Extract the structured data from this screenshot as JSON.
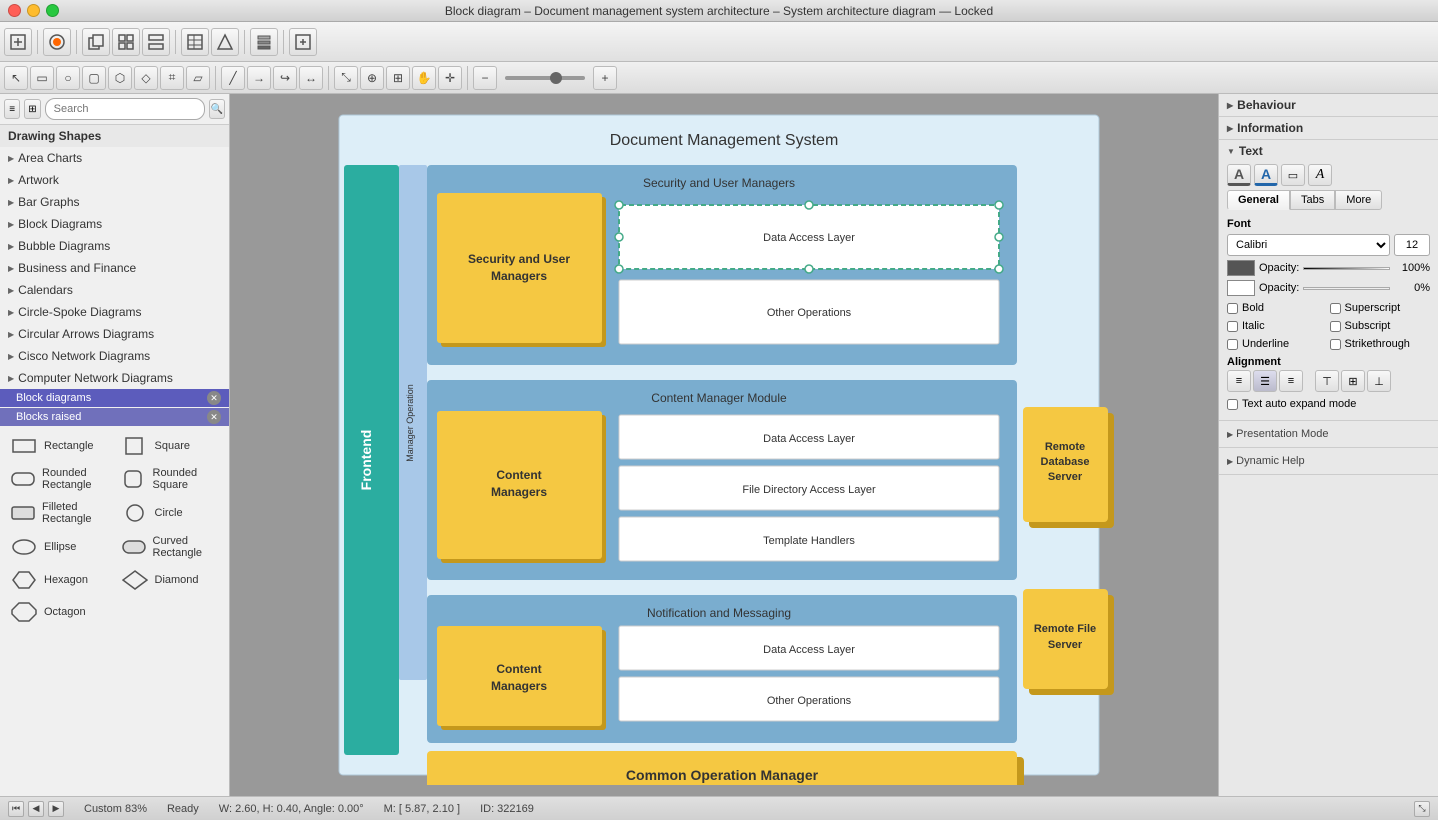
{
  "titlebar": {
    "title": "Block diagram – Document management system architecture – System architecture diagram — Locked"
  },
  "toolbar1": {
    "buttons": [
      "grid",
      "circle",
      "arrow-right",
      "shapes",
      "link",
      "table",
      "pentagon",
      "layers",
      "expand"
    ]
  },
  "toolbar2": {
    "buttons": [
      "cursor",
      "rect",
      "ellipse",
      "rounded",
      "process",
      "diamond",
      "cylinder",
      "parallelogram",
      "arrow-l",
      "arrow-r",
      "arrow-bend",
      "arrow-double",
      "scale",
      "zoom-fit",
      "zoom-select",
      "hand",
      "crosshair"
    ],
    "zoom": "Custom 83%"
  },
  "sidebar": {
    "search_placeholder": "Search",
    "section_title": "Drawing Shapes",
    "categories": [
      {
        "label": "Area Charts",
        "has_arrow": true
      },
      {
        "label": "Artwork",
        "has_arrow": true
      },
      {
        "label": "Bar Graphs",
        "has_arrow": true
      },
      {
        "label": "Block Diagrams",
        "has_arrow": true
      },
      {
        "label": "Bubble Diagrams",
        "has_arrow": true
      },
      {
        "label": "Business and Finance",
        "has_arrow": true
      },
      {
        "label": "Calendars",
        "has_arrow": true
      },
      {
        "label": "Circle-Spoke Diagrams",
        "has_arrow": true
      },
      {
        "label": "Circular Arrows Diagrams",
        "has_arrow": true
      },
      {
        "label": "Cisco Network Diagrams",
        "has_arrow": true
      },
      {
        "label": "Computer Network Diagrams",
        "has_arrow": true
      }
    ],
    "sub_categories": [
      {
        "label": "Block diagrams",
        "active": true
      },
      {
        "label": "Blocks raised",
        "active": false
      }
    ],
    "shapes": [
      {
        "label": "Rectangle",
        "shape": "rect"
      },
      {
        "label": "Square",
        "shape": "square"
      },
      {
        "label": "Rounded Rectangle",
        "shape": "rounded-rect"
      },
      {
        "label": "Rounded Square",
        "shape": "rounded-square"
      },
      {
        "label": "Filleted Rectangle",
        "shape": "filleted-rect"
      },
      {
        "label": "Circle",
        "shape": "circle"
      },
      {
        "label": "Ellipse",
        "shape": "ellipse"
      },
      {
        "label": "Curved Rectangle",
        "shape": "curved-rect"
      },
      {
        "label": "Hexagon",
        "shape": "hexagon"
      },
      {
        "label": "Diamond",
        "shape": "diamond"
      },
      {
        "label": "Octagon",
        "shape": "octagon"
      }
    ]
  },
  "diagram": {
    "title": "Document Management System",
    "frontend_label": "Frontend",
    "manager_op_label": "Manager Operation",
    "sections": [
      {
        "id": "security",
        "title": "Security and User Managers",
        "yellow_label": "Security and User Managers",
        "ops": [
          "Data Access Layer",
          "Other Operations"
        ]
      },
      {
        "id": "content-manager",
        "title": "Content Manager Module",
        "yellow_label": "Content Managers",
        "ops": [
          "Data Access Layer",
          "File Directory Access Layer",
          "Template Handlers"
        ]
      },
      {
        "id": "notification",
        "title": "Notification and Messaging",
        "yellow_label": "Content Managers",
        "ops": [
          "Data Access Layer",
          "Other Operations"
        ]
      }
    ],
    "common_op": "Common Operation Manager",
    "servers": [
      {
        "label": "Remote Database Server"
      },
      {
        "label": "Remote File Server"
      }
    ]
  },
  "right_panel": {
    "behaviour_title": "Behaviour",
    "information_label": "Information",
    "text_label": "Text",
    "font_label": "Font",
    "font_name": "Calibri",
    "font_size": "12",
    "opacity1_label": "Opacity:",
    "opacity1_value": "100%",
    "opacity2_label": "Opacity:",
    "opacity2_value": "0%",
    "tabs": [
      "General",
      "Tabs",
      "More"
    ],
    "active_tab": "General",
    "checkboxes": [
      {
        "label": "Bold",
        "checked": false
      },
      {
        "label": "Superscript",
        "checked": false
      },
      {
        "label": "Italic",
        "checked": false
      },
      {
        "label": "Subscript",
        "checked": false
      },
      {
        "label": "Underline",
        "checked": false
      },
      {
        "label": "Strikethrough",
        "checked": false
      }
    ],
    "alignment_label": "Alignment",
    "text_auto_expand": "Text auto expand mode",
    "presentation_mode": "Presentation Mode",
    "dynamic_help": "Dynamic Help"
  },
  "statusbar": {
    "ready": "Ready",
    "dimensions": "W: 2.60, H: 0.40, Angle: 0.00°",
    "position": "M: [ 5.87, 2.10 ]",
    "id": "ID: 322169",
    "zoom": "Custom 83%"
  }
}
